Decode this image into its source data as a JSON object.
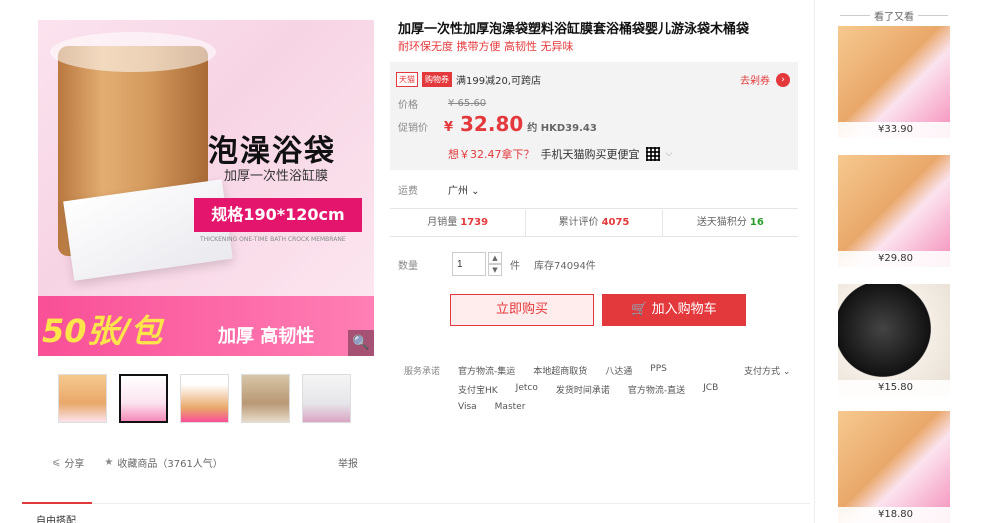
{
  "gallery": {
    "headline": "泡澡浴袋",
    "subline": "加厚一次性浴缸膜",
    "spec": "规格190*120cm",
    "eng": "THICKENING ONE-TIME BATH CROCK MEMBRANE",
    "big": "50张/包",
    "thick": "加厚 高韧性"
  },
  "actions": {
    "share": "分享",
    "favorite": "收藏商品（3761人气）",
    "report": "举报"
  },
  "left_tab": "自由搭配",
  "product": {
    "title": "加厚一次性加厚泡澡袋塑料浴缸膜套浴桶袋婴儿游泳袋木桶袋",
    "subtitle": "耐环保无度 携带方便 高韧性 无异味",
    "promo_tag_tmall": "天猫",
    "promo_tag_cart": "购物券",
    "promo_text": "满199减20,可跨店",
    "coupon": "去剁券",
    "orig_label": "价格",
    "orig_price": "¥ 65.60",
    "sale_label": "促销价",
    "sale_currency": "¥",
    "sale_price": "32.80",
    "hkd": "约 HKD39.43",
    "wish": "想￥32.47拿下？",
    "wish_app": "手机天猫购买更便宜",
    "ship_label": "运费",
    "ship_loc": "广州",
    "stats": [
      {
        "label": "月销量",
        "value": "1739"
      },
      {
        "label": "累计评价",
        "value": "4075"
      },
      {
        "label": "送天猫积分",
        "value": "16"
      }
    ],
    "qty_label": "数量",
    "qty_value": "1",
    "qty_unit": "件",
    "stock": "库存74094件",
    "buy_now": "立即购买",
    "add_cart": "加入购物车",
    "service_label": "服务承诺",
    "service_items": [
      "官方物流-集运",
      "本地超商取货",
      "八达通",
      "PPS",
      "支付宝HK",
      "Jetco",
      "发货时间承诺",
      "官方物流-直送",
      "JCB",
      "Visa",
      "Master"
    ],
    "pay": "支付方式"
  },
  "rail": {
    "title": "看了又看",
    "items": [
      {
        "price": "¥33.90"
      },
      {
        "price": "¥29.80"
      },
      {
        "price": "¥15.80"
      },
      {
        "price": "¥18.80"
      }
    ]
  }
}
